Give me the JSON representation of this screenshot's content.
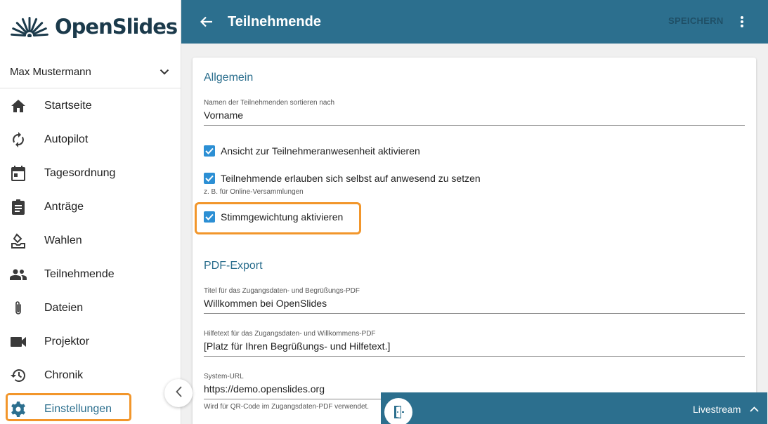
{
  "app": {
    "name": "OpenSlides"
  },
  "user": {
    "name": "Max Mustermann"
  },
  "sidebar": {
    "items": [
      {
        "label": "Startseite",
        "icon": "home-icon"
      },
      {
        "label": "Autopilot",
        "icon": "sync-icon"
      },
      {
        "label": "Tagesordnung",
        "icon": "calendar-icon"
      },
      {
        "label": "Anträge",
        "icon": "clipboard-icon"
      },
      {
        "label": "Wahlen",
        "icon": "ballot-icon"
      },
      {
        "label": "Teilnehmende",
        "icon": "people-icon"
      },
      {
        "label": "Dateien",
        "icon": "paperclip-icon"
      },
      {
        "label": "Projektor",
        "icon": "videocam-icon"
      },
      {
        "label": "Chronik",
        "icon": "history-icon"
      },
      {
        "label": "Einstellungen",
        "icon": "gear-icon",
        "active": true
      }
    ]
  },
  "header": {
    "title": "Teilnehmende",
    "save_label": "SPEICHERN"
  },
  "settings": {
    "general": {
      "title": "Allgemein",
      "sort_label": "Namen der Teilnehmenden sortieren nach",
      "sort_value": "Vorname",
      "presence_view_label": "Ansicht zur Teilnehmeranwesenheit aktivieren",
      "self_presence_label": "Teilnehmende erlauben sich selbst auf anwesend zu setzen",
      "self_presence_hint": "z. B. für Online-Versammlungen",
      "vote_weight_label": "Stimmgewichtung aktivieren"
    },
    "pdf": {
      "title": "PDF-Export",
      "pdf_title_label": "Titel für das Zugangsdaten- und Begrüßungs-PDF",
      "pdf_title_value": "Willkommen bei OpenSlides",
      "help_text_label": "Hilfetext für das Zugangsdaten- und Willkommens-PDF",
      "help_text_value": "[Platz für Ihren Begrüßungs- und Hilfetext.]",
      "system_url_label": "System-URL",
      "system_url_value": "https://demo.openslides.org",
      "system_url_hint": "Wird für QR-Code im Zugangsdaten-PDF verwendet."
    }
  },
  "livestream": {
    "label": "Livestream"
  },
  "colors": {
    "primary": "#2c6f8e",
    "highlight": "#f2962b",
    "checkbox": "#2c8fd4"
  }
}
